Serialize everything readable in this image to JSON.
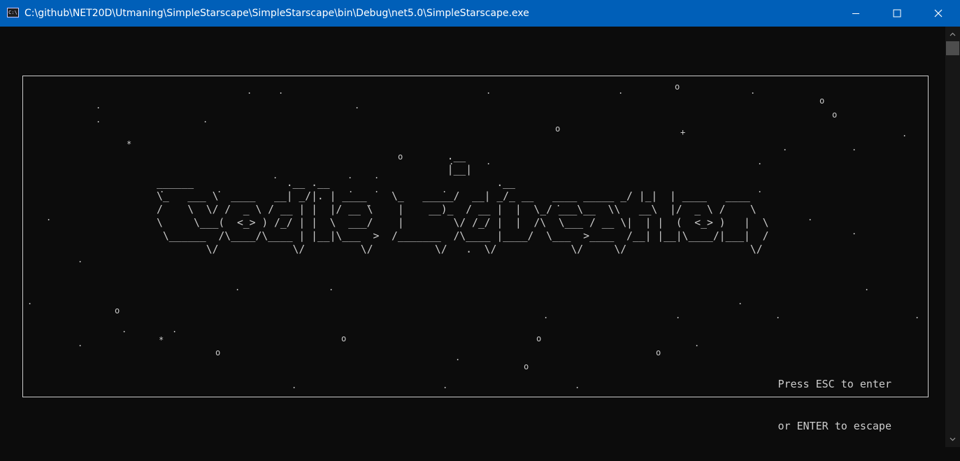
{
  "window": {
    "title": "C:\\github\\NET20D\\Utmaning\\SimpleStarscape\\SimpleStarscape\\bin\\Debug\\net5.0\\SimpleStarscape.exe",
    "icon": "cmd-icon",
    "icon_text": "C:\\"
  },
  "colors": {
    "titlebar": "#005fb8",
    "console_background": "#0c0c0c",
    "console_text": "#cccccc"
  },
  "logo": {
    "ascii": [
      "                                               .__",
      "                                               |__|",
      "______               .__ .__                           .__",
      "\\_   ___ \\  ____   __| _/|. | ____    \\_   _____/  __| _/_ __   ____ _____ _/ |_|  | ____   ____",
      "/    \\  \\/ /  _ \\ / __ | |  |/ __ \\    |    __)_  / __ |  |  \\_/ ___\\__  \\\\   __\\  |/  _ \\ /    \\",
      "\\     \\___(  <_> ) /_/ | |  \\  ___/    |        \\/ /_/ |  |  /\\  \\___ / __ \\|  | |  (  <_> )   |  \\",
      " \\______  /\\____/\\____ | |__|\\___  >  /_______  /\\____ |____/  \\___  >____  /__| |__|\\____/|___|  /",
      "        \\/            \\/         \\/          \\/   .  \\/            \\/     \\/                    \\/"
    ]
  },
  "hint": {
    "line1": "Press ESC to enter",
    "line2": "or ENTER to escape"
  }
}
